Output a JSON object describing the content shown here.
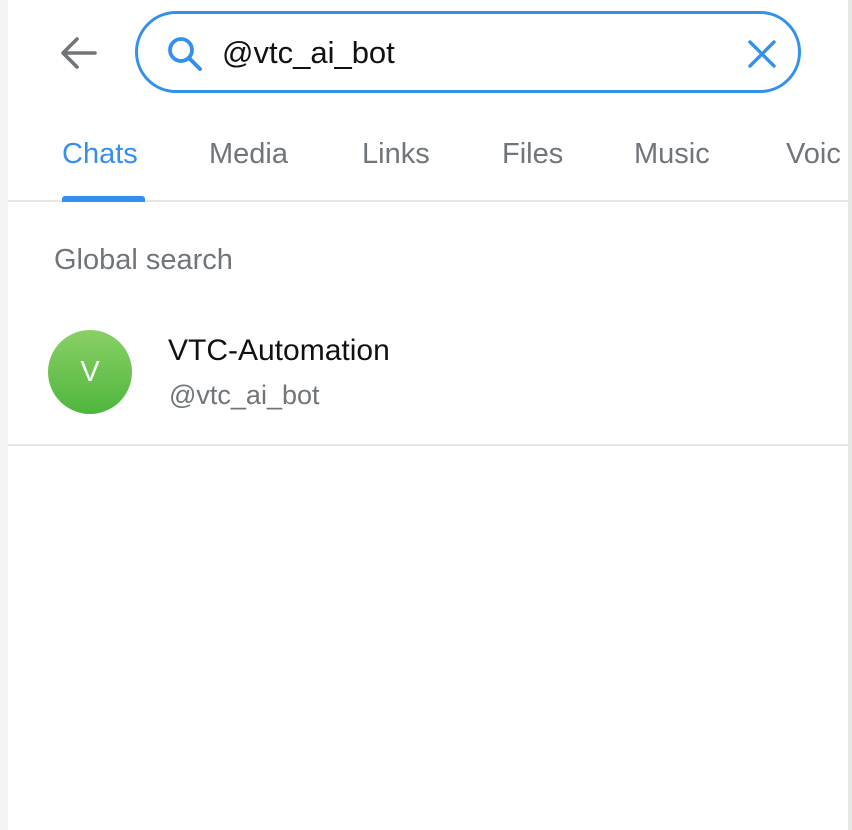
{
  "search": {
    "query": "@vtc_ai_bot"
  },
  "tabs": [
    {
      "label": "Chats",
      "active": true
    },
    {
      "label": "Media",
      "active": false
    },
    {
      "label": "Links",
      "active": false
    },
    {
      "label": "Files",
      "active": false
    },
    {
      "label": "Music",
      "active": false
    },
    {
      "label": "Voic",
      "active": false
    }
  ],
  "global_search": {
    "title": "Global search",
    "results": [
      {
        "avatar_letter": "V",
        "name": "VTC-Automation",
        "username": "@vtc_ai_bot"
      }
    ]
  },
  "icons": {
    "back": "arrow-left-icon",
    "search": "search-icon",
    "clear": "close-icon"
  },
  "colors": {
    "accent": "#3390ec",
    "secondary_text": "#707579",
    "avatar_green": "#5cbf47"
  }
}
